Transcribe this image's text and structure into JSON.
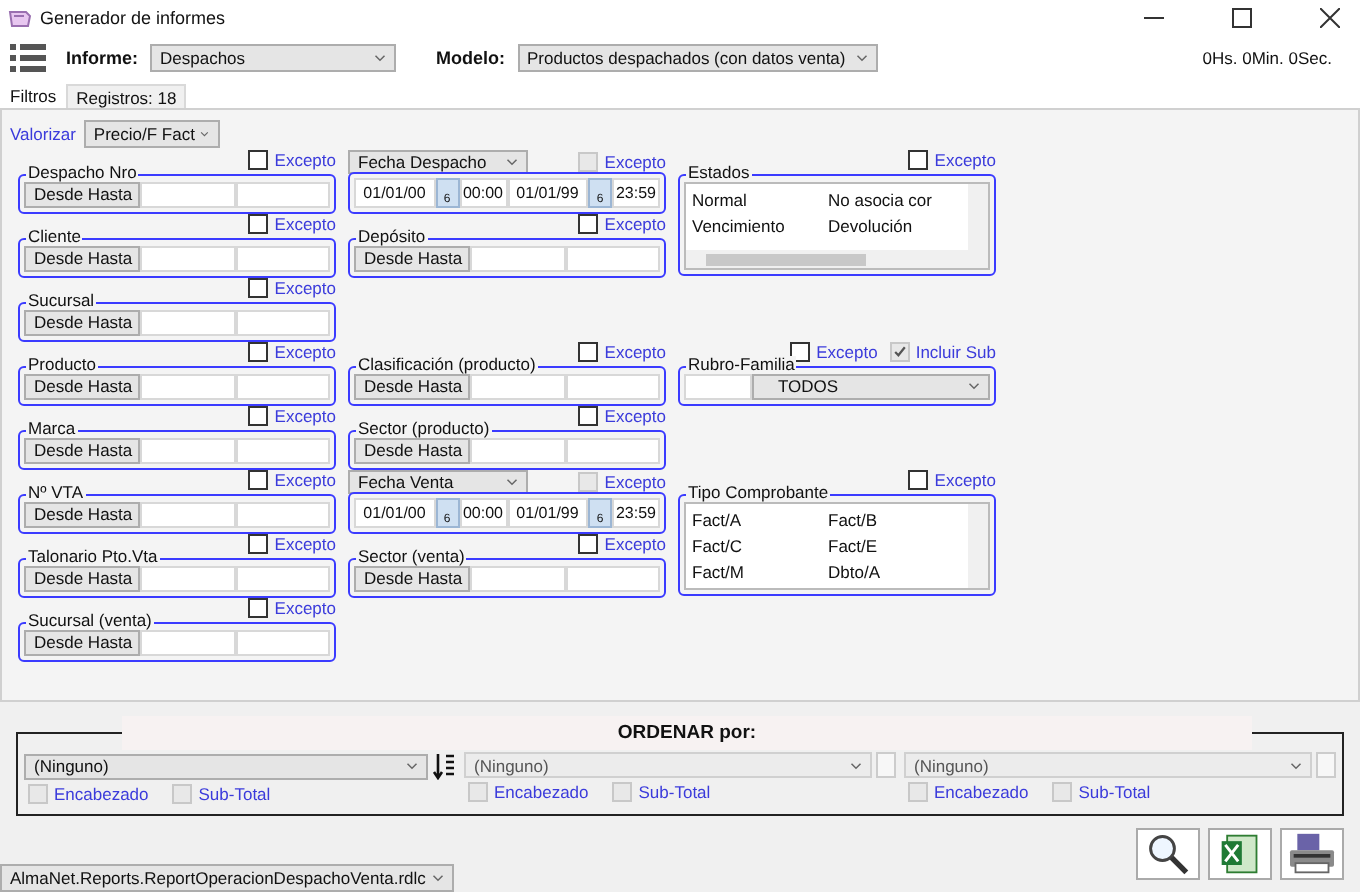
{
  "window": {
    "title": "Generador de informes"
  },
  "toolbar": {
    "informe_label": "Informe:",
    "informe_value": "Despachos",
    "modelo_label": "Modelo:",
    "modelo_value": "Productos despachados (con datos venta)",
    "timer": "0Hs. 0Min. 0Sec."
  },
  "tabs": [
    {
      "label": "Filtros",
      "selected": true
    },
    {
      "label": "Registros: 18",
      "selected": false
    }
  ],
  "valorizar": {
    "label": "Valorizar",
    "value": "Precio/F Fact"
  },
  "filter_columns": [
    [
      {
        "kind": "range",
        "title": "Despacho Nro",
        "mode": "Desde Hasta",
        "excepto": {
          "label": "Excepto",
          "checked": false,
          "disabled": false
        }
      },
      {
        "kind": "range",
        "title": "Cliente",
        "mode": "Desde Hasta",
        "excepto": {
          "label": "Excepto",
          "checked": false,
          "disabled": false
        }
      },
      {
        "kind": "range",
        "title": "Sucursal",
        "mode": "Desde Hasta",
        "excepto": {
          "label": "Excepto",
          "checked": false,
          "disabled": false
        }
      },
      {
        "kind": "range",
        "title": "Producto",
        "mode": "Desde Hasta",
        "excepto": {
          "label": "Excepto",
          "checked": false,
          "disabled": false
        }
      },
      {
        "kind": "range",
        "title": "Marca",
        "mode": "Desde Hasta",
        "excepto": {
          "label": "Excepto",
          "checked": false,
          "disabled": false
        }
      },
      {
        "kind": "range",
        "title": "Nº VTA",
        "mode": "Desde Hasta",
        "excepto": {
          "label": "Excepto",
          "checked": false,
          "disabled": false
        }
      },
      {
        "kind": "range",
        "title": "Talonario Pto.Vta",
        "mode": "Desde Hasta",
        "excepto": {
          "label": "Excepto",
          "checked": false,
          "disabled": false
        }
      },
      {
        "kind": "range",
        "title": "Sucursal (venta)",
        "mode": "Desde Hasta",
        "excepto": {
          "label": "Excepto",
          "checked": false,
          "disabled": false
        }
      }
    ],
    [
      {
        "kind": "date",
        "selector": "Fecha Despacho",
        "from_date": "01/01/00",
        "from_day": "6",
        "from_time": "00:00",
        "to_date": "01/01/99",
        "to_day": "6",
        "to_time": "23:59",
        "excepto": {
          "label": "Excepto",
          "checked": false,
          "disabled": true
        }
      },
      {
        "kind": "range",
        "title": "Depósito",
        "mode": "Desde Hasta",
        "excepto": {
          "label": "Excepto",
          "checked": false,
          "disabled": false
        }
      },
      {
        "kind": "spacer"
      },
      {
        "kind": "range",
        "title": "Clasificación (producto)",
        "mode": "Desde Hasta",
        "excepto": {
          "label": "Excepto",
          "checked": false,
          "disabled": false
        }
      },
      {
        "kind": "range",
        "title": "Sector (producto)",
        "mode": "Desde Hasta",
        "excepto": {
          "label": "Excepto",
          "checked": false,
          "disabled": false
        }
      },
      {
        "kind": "date",
        "selector": "Fecha Venta",
        "from_date": "01/01/00",
        "from_day": "6",
        "from_time": "00:00",
        "to_date": "01/01/99",
        "to_day": "6",
        "to_time": "23:59",
        "excepto": {
          "label": "Excepto",
          "checked": false,
          "disabled": true
        }
      },
      {
        "kind": "range",
        "title": "Sector (venta)",
        "mode": "Desde Hasta",
        "excepto": {
          "label": "Excepto",
          "checked": false,
          "disabled": false
        }
      }
    ],
    [
      {
        "kind": "list",
        "title": "Estados",
        "h_scroll": true,
        "rows": [
          [
            "Normal",
            "No asocia cor"
          ],
          [
            "Vencimiento",
            "Devolución"
          ]
        ],
        "excepto": {
          "label": "Excepto",
          "checked": false,
          "disabled": false
        }
      },
      {
        "kind": "spacer"
      },
      {
        "kind": "combo",
        "title": "Rubro-Familia",
        "value": "TODOS",
        "excepto": {
          "label": "Excepto",
          "checked": false,
          "disabled": false
        },
        "incluir_sub": {
          "label": "Incluir Sub",
          "checked": true,
          "disabled": true
        }
      },
      {
        "kind": "spacer"
      },
      {
        "kind": "list",
        "title": "Tipo Comprobante",
        "h_scroll": false,
        "rows": [
          [
            "Fact/A",
            "Fact/B"
          ],
          [
            "Fact/C",
            "Fact/E"
          ],
          [
            "Fact/M",
            "Dbto/A"
          ]
        ],
        "excepto": {
          "label": "Excepto",
          "checked": false,
          "disabled": false
        }
      }
    ]
  ],
  "ordenar": {
    "title": "ORDENAR  por:",
    "slots": [
      {
        "value": "(Ninguno)",
        "disabled": false,
        "checks": [
          {
            "label": "Encabezado",
            "checked": false,
            "disabled": true
          },
          {
            "label": "Sub-Total",
            "checked": false,
            "disabled": true
          }
        ]
      },
      {
        "value": "(Ninguno)",
        "disabled": true,
        "checks": [
          {
            "label": "Encabezado",
            "checked": false,
            "disabled": true
          },
          {
            "label": "Sub-Total",
            "checked": false,
            "disabled": true
          }
        ]
      },
      {
        "value": "(Ninguno)",
        "disabled": true,
        "checks": [
          {
            "label": "Encabezado",
            "checked": false,
            "disabled": true
          },
          {
            "label": "Sub-Total",
            "checked": false,
            "disabled": true
          }
        ]
      }
    ]
  },
  "report_file": "AlmaNet.Reports.ReportOperacionDespachoVenta.rdlc"
}
